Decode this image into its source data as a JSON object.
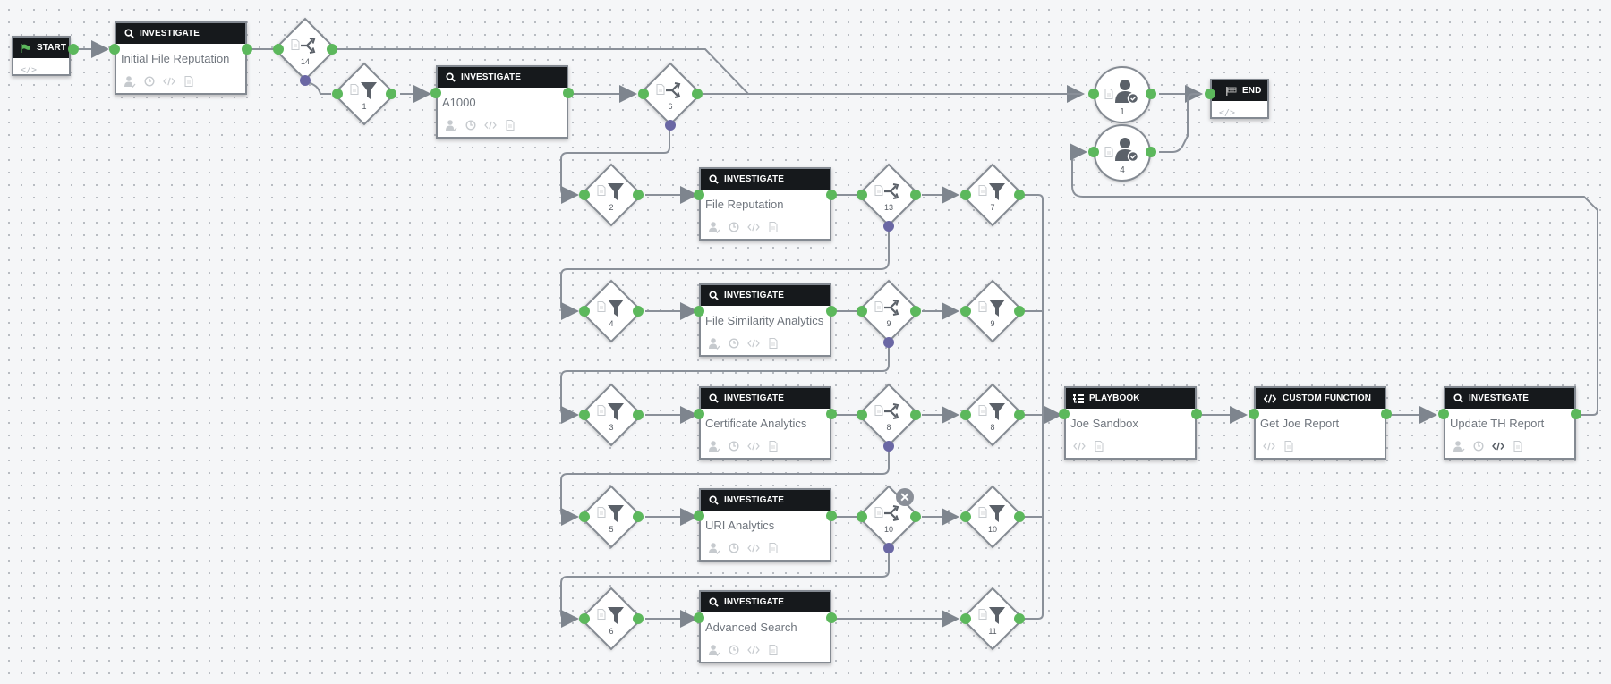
{
  "colors": {
    "header_bg": "#16191c",
    "port_success": "#5cb85c",
    "port_alt": "#6a67a4",
    "edge": "#8a9099",
    "start_flag": "#5cb85c"
  },
  "start": {
    "label": "START",
    "icon": "flag-icon",
    "footer_icons": [
      "code-icon"
    ]
  },
  "end": {
    "label": "END",
    "icon": "finish-flag-icon",
    "footer_icons": [
      "code-icon"
    ]
  },
  "blocks": [
    {
      "id": "initial-file-reputation",
      "type": "INVESTIGATE",
      "icon": "search-icon",
      "title": "Initial File Reputation",
      "footer_icons": [
        "user-approval-icon",
        "clock-icon",
        "code-icon",
        "document-icon"
      ]
    },
    {
      "id": "a1000",
      "type": "INVESTIGATE",
      "icon": "search-icon",
      "title": "A1000",
      "footer_icons": [
        "user-approval-icon",
        "clock-icon",
        "code-icon",
        "document-icon"
      ]
    },
    {
      "id": "file-reputation",
      "type": "INVESTIGATE",
      "icon": "search-icon",
      "title": "File Reputation",
      "footer_icons": [
        "user-approval-icon",
        "clock-icon",
        "code-icon",
        "document-icon"
      ]
    },
    {
      "id": "file-similarity-analytics",
      "type": "INVESTIGATE",
      "icon": "search-icon",
      "title": "File Similarity Analytics",
      "footer_icons": [
        "user-approval-icon",
        "clock-icon",
        "code-icon",
        "document-icon"
      ]
    },
    {
      "id": "certificate-analytics",
      "type": "INVESTIGATE",
      "icon": "search-icon",
      "title": "Certificate Analytics",
      "footer_icons": [
        "user-approval-icon",
        "clock-icon",
        "code-icon",
        "document-icon"
      ]
    },
    {
      "id": "uri-analytics",
      "type": "INVESTIGATE",
      "icon": "search-icon",
      "title": "URI Analytics",
      "footer_icons": [
        "user-approval-icon",
        "clock-icon",
        "code-icon",
        "document-icon"
      ]
    },
    {
      "id": "advanced-search",
      "type": "INVESTIGATE",
      "icon": "search-icon",
      "title": "Advanced Search",
      "footer_icons": [
        "user-approval-icon",
        "clock-icon",
        "code-icon",
        "document-icon"
      ]
    },
    {
      "id": "joe-sandbox",
      "type": "PLAYBOOK",
      "icon": "playbook-icon",
      "title": "Joe Sandbox",
      "footer_icons": [
        "code-icon",
        "document-icon"
      ]
    },
    {
      "id": "get-joe-report",
      "type": "CUSTOM FUNCTION",
      "icon": "code-icon",
      "title": "Get Joe Report",
      "footer_icons": [
        "code-icon",
        "document-icon"
      ]
    },
    {
      "id": "update-th-report",
      "type": "INVESTIGATE",
      "icon": "search-icon",
      "title": "Update TH Report",
      "footer_icons": [
        "user-approval-icon",
        "clock-icon",
        "code-icon",
        "document-icon"
      ]
    }
  ],
  "decisions": [
    {
      "id": "decision-14",
      "number": "14"
    },
    {
      "id": "decision-6",
      "number": "6"
    },
    {
      "id": "decision-13",
      "number": "13"
    },
    {
      "id": "decision-9",
      "number": "9"
    },
    {
      "id": "decision-8",
      "number": "8"
    },
    {
      "id": "decision-10",
      "number": "10",
      "selected": true
    }
  ],
  "filters": [
    {
      "id": "filter-1",
      "number": "1"
    },
    {
      "id": "filter-2",
      "number": "2"
    },
    {
      "id": "filter-4",
      "number": "4"
    },
    {
      "id": "filter-3",
      "number": "3"
    },
    {
      "id": "filter-5",
      "number": "5"
    },
    {
      "id": "filter-6",
      "number": "6"
    },
    {
      "id": "filter-7",
      "number": "7"
    },
    {
      "id": "filter-9",
      "number": "9"
    },
    {
      "id": "filter-8",
      "number": "8"
    },
    {
      "id": "filter-10",
      "number": "10"
    },
    {
      "id": "filter-11",
      "number": "11"
    }
  ],
  "prompts": [
    {
      "id": "prompt-1",
      "number": "1"
    },
    {
      "id": "prompt-4",
      "number": "4"
    }
  ],
  "delete_button": {
    "label": "✕"
  }
}
